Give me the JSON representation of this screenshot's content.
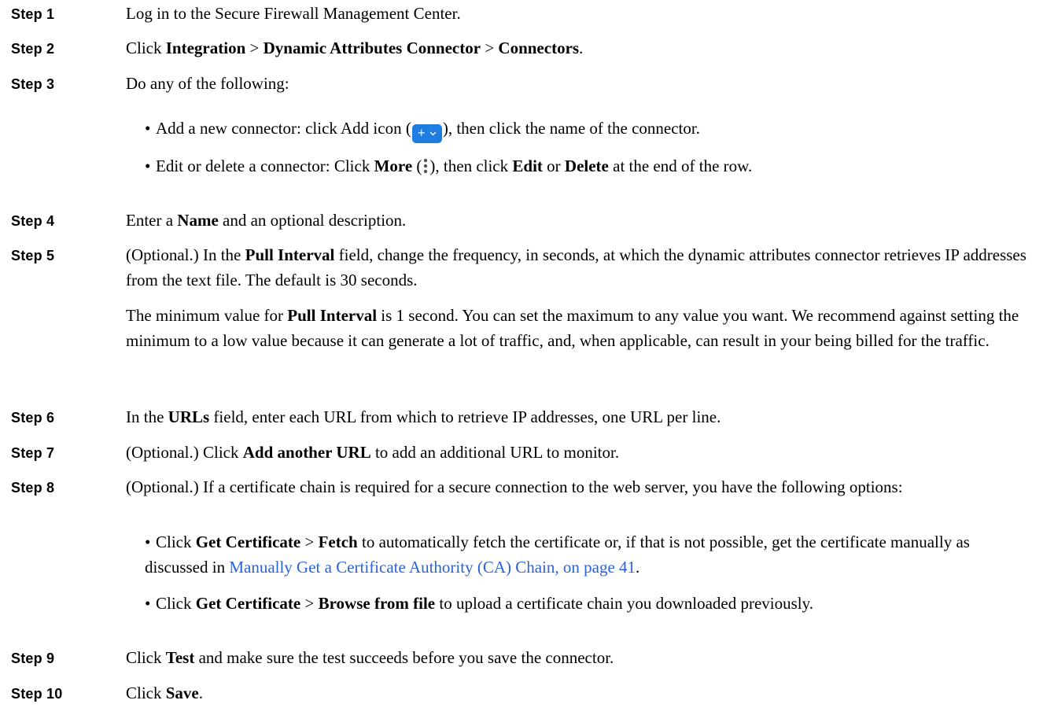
{
  "steps": [
    {
      "label": "Step 1",
      "segments": [
        "Log in to the Secure Firewall Management Center."
      ]
    },
    {
      "label": "Step 2",
      "parts": [
        "Click ",
        "Integration",
        " > ",
        "Dynamic Attributes Connector",
        " >  ",
        "Connectors",
        "."
      ]
    },
    {
      "label": "Step 3",
      "parts": [
        "Do any of the following:"
      ]
    },
    {
      "label": "Step 4",
      "parts": [
        "Enter a ",
        "Name",
        " and an optional description."
      ]
    },
    {
      "label": "Step 5",
      "parts": [
        "(Optional.) In the ",
        "Pull Interval",
        " field, change the frequency, in seconds, at which the dynamic attributes connector retrieves IP addresses from the text file. The default is 30 seconds."
      ]
    },
    {
      "label": "Step 6",
      "parts": [
        "In the ",
        "URLs",
        " field, enter each URL from which to retrieve IP addresses, one URL per line."
      ]
    },
    {
      "label": "Step 7",
      "parts": [
        "(Optional.) Click ",
        "Add another URL",
        " to add an additional URL to monitor."
      ]
    },
    {
      "label": "Step 8",
      "parts": [
        "(Optional.) If a certificate chain is required for a secure connection to the web server, you have the following options:"
      ]
    },
    {
      "label": "Step 9",
      "parts": [
        "Click ",
        "Test",
        " and make sure the test succeeds before you save the connector."
      ]
    },
    {
      "label": "Step 10",
      "parts": [
        "Click ",
        "Save",
        "."
      ]
    }
  ],
  "step3_bullets": {
    "add": [
      "• ",
      "Add a new connector: click Add icon (",
      "), then click the name of the connector."
    ],
    "edit": [
      "• ",
      "Edit or delete a connector: Click ",
      "More",
      " (",
      "), then click ",
      "Edit",
      " or ",
      "Delete",
      " at the end of the row."
    ]
  },
  "step5_note": [
    "The minimum value for ",
    "Pull Interval",
    " is 1 second. You can set the maximum to any value you want. We recommend against setting the minimum to a low value because it can generate a lot of traffic, and, when applicable, can result in your being billed for the traffic."
  ],
  "step8_bullets": {
    "fetch": [
      "• ",
      "Click ",
      "Get Certificate",
      " > ",
      "Fetch",
      " to automatically fetch the certificate or, if that is not possible, get the certificate manually as discussed in ",
      "Manually Get a Certificate Authority (CA) Chain, on page 41",
      "."
    ],
    "browse": [
      "• ",
      "Click ",
      "Get Certificate",
      " > ",
      "Browse from file",
      " to upload a certificate chain you downloaded previously."
    ]
  },
  "icons": {
    "add": "add-dropdown-icon",
    "more": "more-vertical-icon"
  },
  "colors": {
    "link": "#2b62d9",
    "add_icon_bg": "#1f7ce0"
  }
}
